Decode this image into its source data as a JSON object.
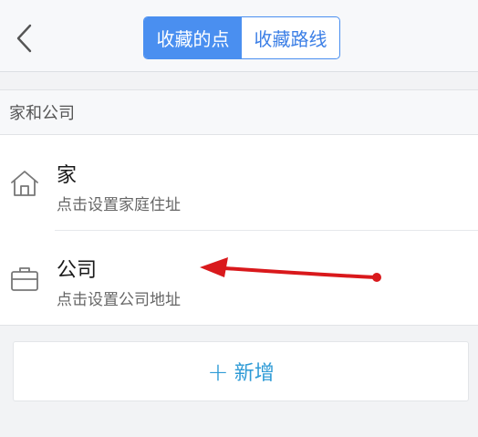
{
  "header": {
    "back_icon": "chevron-left-icon",
    "tabs": [
      {
        "label": "收藏的点",
        "active": true
      },
      {
        "label": "收藏路线",
        "active": false
      }
    ]
  },
  "section": {
    "title": "家和公司"
  },
  "items": [
    {
      "icon": "home-icon",
      "title": "家",
      "subtitle": "点击设置家庭住址"
    },
    {
      "icon": "briefcase-icon",
      "title": "公司",
      "subtitle": "点击设置公司地址"
    }
  ],
  "add_button": {
    "plus": "+",
    "label": "新增"
  },
  "colors": {
    "accent": "#4a8ff0",
    "add_text": "#2f9bd6",
    "annotation_arrow": "#d9191c"
  }
}
